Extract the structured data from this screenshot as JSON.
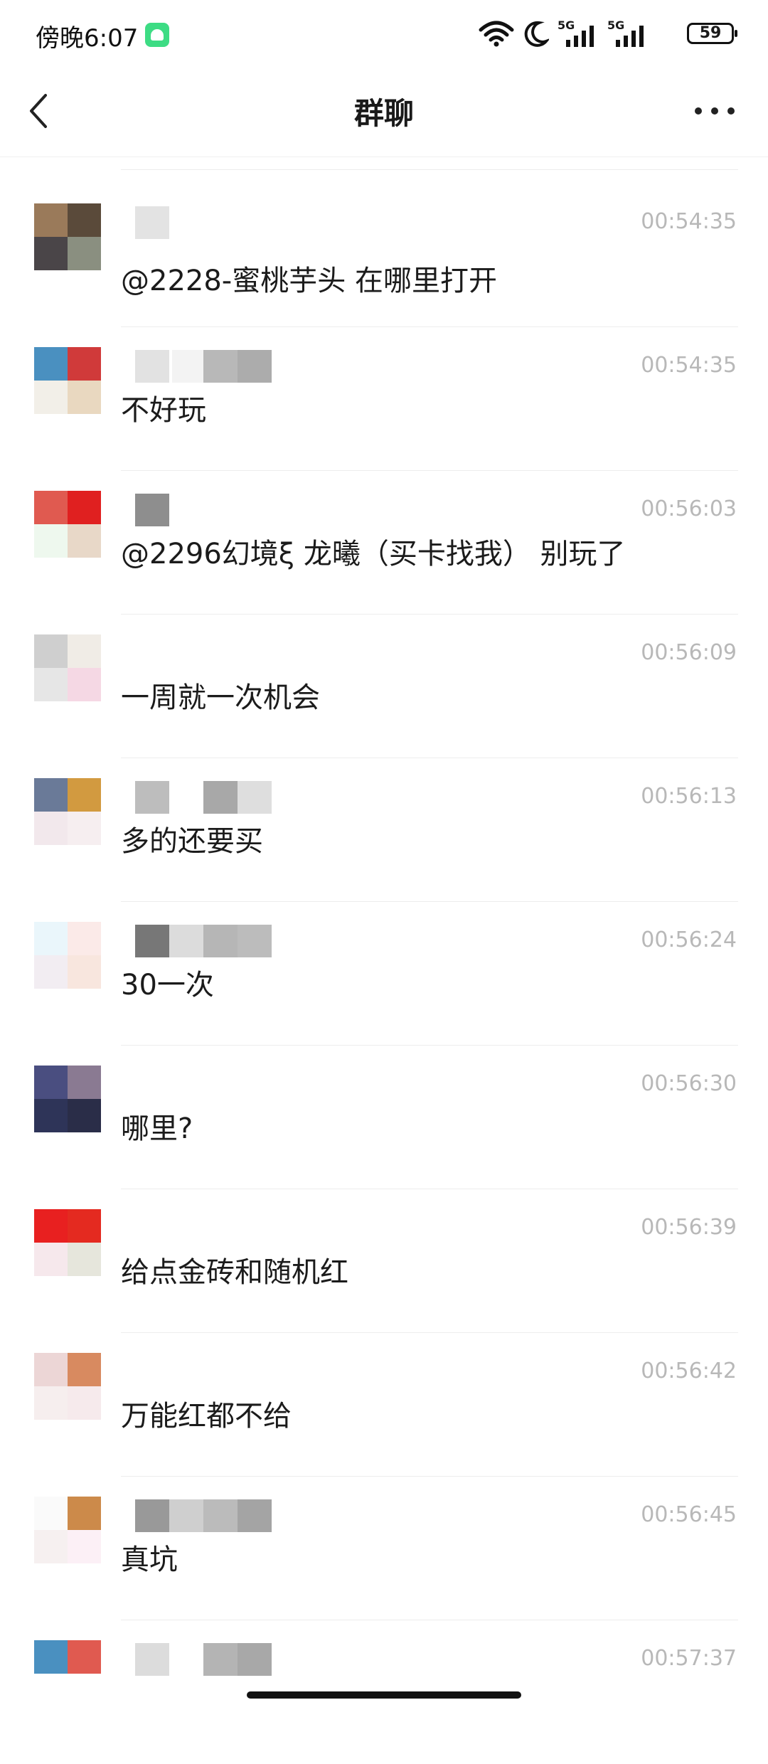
{
  "status_bar": {
    "time": "傍晚6:07",
    "network_1": "5G",
    "network_2": "5G",
    "battery": "59"
  },
  "header": {
    "title": "群聊"
  },
  "messages": [
    {
      "time": "00:54:35",
      "text": "@2228-蜜桃芋头 在哪里打开",
      "avatar_colors": [
        "#9a7a5a",
        "#5a4a3a",
        "#4a4548",
        "#8a8f80"
      ]
    },
    {
      "time": "00:54:35",
      "text": "不好玩",
      "avatar_colors": [
        "#4a90c0",
        "#d03a3a",
        "#f2efe8",
        "#e9d8c0"
      ]
    },
    {
      "time": "00:56:03",
      "text": "@2296幻境ξ 龙曦（买卡找我） 别玩了",
      "avatar_colors": [
        "#e05a50",
        "#e02020",
        "#eef8ee",
        "#e8d8c8"
      ]
    },
    {
      "time": "00:56:09",
      "text": "一周就一次机会",
      "avatar_colors": [
        "#cfcfcf",
        "#f0ece6",
        "#e6e6e6",
        "#f5d8e4"
      ]
    },
    {
      "time": "00:56:13",
      "text": "多的还要买",
      "avatar_colors": [
        "#6a7a98",
        "#d29a40",
        "#f2e8ec",
        "#f6eef0"
      ]
    },
    {
      "time": "00:56:24",
      "text": "30一次",
      "avatar_colors": [
        "#eaf6fb",
        "#fbeae8",
        "#f2edf2",
        "#f8e6de"
      ]
    },
    {
      "time": "00:56:30",
      "text": "哪里?",
      "avatar_colors": [
        "#4a4e80",
        "#8a7a92",
        "#2e3458",
        "#2a2d48"
      ]
    },
    {
      "time": "00:56:39",
      "text": "给点金砖和随机红",
      "avatar_colors": [
        "#e82020",
        "#e42a20",
        "#f6e8ec",
        "#e6e6dc"
      ]
    },
    {
      "time": "00:56:42",
      "text": "万能红都不给",
      "avatar_colors": [
        "#ecd6d6",
        "#d88a60",
        "#f6eeee",
        "#f6eaec"
      ]
    },
    {
      "time": "00:56:45",
      "text": "真坑",
      "avatar_colors": [
        "#fafafa",
        "#cc8a4a",
        "#f6f0f0",
        "#fcf0f6"
      ]
    },
    {
      "time": "00:57:37",
      "text": "",
      "avatar_colors": [
        "#4a90c0",
        "#e05a50",
        "#ffffff",
        "#ffffff"
      ]
    }
  ]
}
